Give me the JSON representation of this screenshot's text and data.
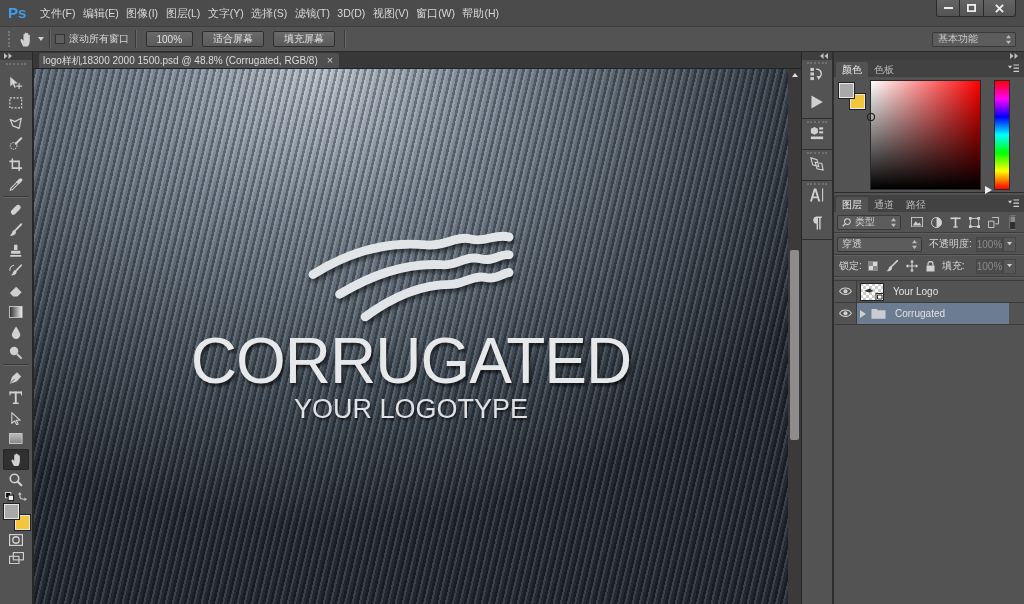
{
  "menu_bar": {
    "logo": "Ps",
    "items": [
      "文件(F)",
      "编辑(E)",
      "图像(I)",
      "图层(L)",
      "文字(Y)",
      "选择(S)",
      "滤镜(T)",
      "3D(D)",
      "视图(V)",
      "窗口(W)",
      "帮助(H)"
    ],
    "window_controls": [
      {
        "kind": "minimize"
      },
      {
        "kind": "maximize"
      },
      {
        "kind": "close"
      }
    ]
  },
  "options_bar": {
    "scroll_all_windows": {
      "label": "滚动所有窗口",
      "checked": false
    },
    "buttons": [
      "100%",
      "适合屏幕",
      "填充屏幕"
    ],
    "workspace": "基本功能"
  },
  "toolbar": {
    "tool_groups": [
      {
        "tools": [
          {
            "kind": "move",
            "selected": false
          },
          {
            "kind": "marquee",
            "selected": false
          },
          {
            "kind": "lasso",
            "selected": false
          },
          {
            "kind": "quick_select",
            "selected": false
          },
          {
            "kind": "crop",
            "selected": false
          },
          {
            "kind": "eyedropper",
            "selected": false
          }
        ]
      },
      {
        "tools": [
          {
            "kind": "healing",
            "selected": false
          },
          {
            "kind": "brush",
            "selected": false
          },
          {
            "kind": "stamp",
            "selected": false
          },
          {
            "kind": "history_brush",
            "selected": false
          },
          {
            "kind": "eraser",
            "selected": false
          },
          {
            "kind": "gradient",
            "selected": false
          },
          {
            "kind": "blur",
            "selected": false
          },
          {
            "kind": "dodge",
            "selected": false
          }
        ]
      },
      {
        "tools": [
          {
            "kind": "pen",
            "selected": false
          },
          {
            "kind": "type",
            "selected": false
          },
          {
            "kind": "path_select",
            "selected": false
          },
          {
            "kind": "shape",
            "selected": false
          },
          {
            "kind": "hand",
            "selected": true
          },
          {
            "kind": "zoom",
            "selected": false
          }
        ]
      }
    ],
    "swatches": [
      {
        "kind": "foreground",
        "color": "#a9a9a9"
      },
      {
        "kind": "background",
        "color": "#f1c53c"
      }
    ]
  },
  "document": {
    "tab": {
      "title": "logo样机18300 2000 1500.psd @ 48.8% (Corrugated, RGB/8)",
      "close": "×"
    },
    "canvas": {
      "title": "CORRUGATED",
      "subtitle": "YOUR LOGOTYPE"
    }
  },
  "dock": {
    "groups": [
      {
        "items": [
          {
            "kind": "history"
          },
          {
            "kind": "actions"
          }
        ]
      },
      {
        "items": [
          {
            "kind": "properties"
          }
        ]
      },
      {
        "items": [
          {
            "kind": "glyphs"
          }
        ]
      },
      {
        "items": [
          {
            "kind": "character"
          },
          {
            "kind": "paragraph"
          }
        ]
      }
    ]
  },
  "color_panel": {
    "tabs": [
      {
        "label": "颜色",
        "selected": true
      },
      {
        "label": "色板",
        "selected": false
      }
    ],
    "swatches": [
      {
        "kind": "foreground",
        "color": "#a9a9a9"
      },
      {
        "kind": "background",
        "color": "#f1c53c"
      }
    ],
    "hue_slider": {
      "level": 0
    }
  },
  "layers_panel": {
    "tabs": [
      {
        "label": "图层",
        "selected": true
      },
      {
        "label": "通道",
        "selected": false
      },
      {
        "label": "路径",
        "selected": false
      }
    ],
    "filter": {
      "label": "类型"
    },
    "blend_mode": "穿透",
    "opacity": {
      "label": "不透明度:",
      "value": "100%",
      "disabled": true
    },
    "lock_label": "锁定:",
    "fill": {
      "label": "填充:",
      "value": "100%",
      "disabled": true
    },
    "layers": [
      {
        "name": "Your Logo",
        "kind": "smart_object",
        "visible": true,
        "selected": false
      },
      {
        "name": "Corrugated",
        "kind": "group",
        "visible": true,
        "selected": true,
        "expanded": false
      }
    ]
  }
}
